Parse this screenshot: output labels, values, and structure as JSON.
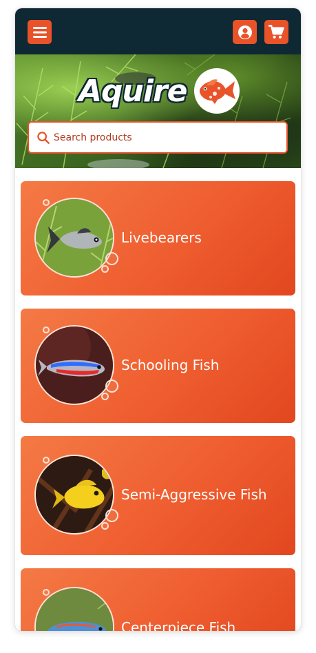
{
  "header": {
    "menu_icon": "hamburger-menu-icon",
    "account_icon": "user-account-icon",
    "cart_icon": "shopping-cart-icon"
  },
  "hero": {
    "brand_name": "Aquire",
    "brand_logo_icon": "fish-logo-icon"
  },
  "search": {
    "placeholder": "Search products",
    "value": ""
  },
  "categories": [
    {
      "label": "Livebearers",
      "image": "guppy-fish-photo"
    },
    {
      "label": "Schooling Fish",
      "image": "neon-tetra-photo"
    },
    {
      "label": "Semi-Aggressive Fish",
      "image": "yellow-cichlid-photo"
    },
    {
      "label": "Centerpiece Fish",
      "image": "blue-gourami-photo"
    }
  ],
  "colors": {
    "topbar": "#0e2834",
    "accent": "#e8532a",
    "card_start": "#f47a45",
    "card_end": "#e2471f"
  }
}
